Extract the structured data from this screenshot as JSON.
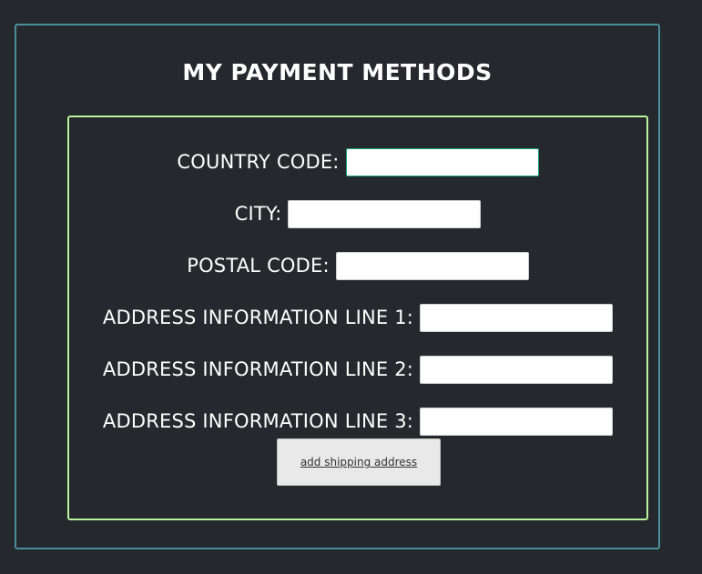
{
  "page": {
    "title": "MY PAYMENT METHODS"
  },
  "form": {
    "fields": [
      {
        "label": "COUNTRY CODE:",
        "value": "",
        "focused": true
      },
      {
        "label": "CITY:",
        "value": "",
        "focused": false
      },
      {
        "label": "POSTAL CODE:",
        "value": "",
        "focused": false
      },
      {
        "label": "ADDRESS INFORMATION LINE 1:",
        "value": "",
        "focused": false
      },
      {
        "label": "ADDRESS INFORMATION LINE 2:",
        "value": "",
        "focused": false
      },
      {
        "label": "ADDRESS INFORMATION LINE 3:",
        "value": "",
        "focused": false
      }
    ],
    "submit_label": "add shipping address"
  },
  "colors": {
    "background": "#25282d",
    "outer_border": "#4b8e9e",
    "form_border": "#b8f49d",
    "focus_border": "#1aa37f",
    "text": "#ffffff"
  }
}
